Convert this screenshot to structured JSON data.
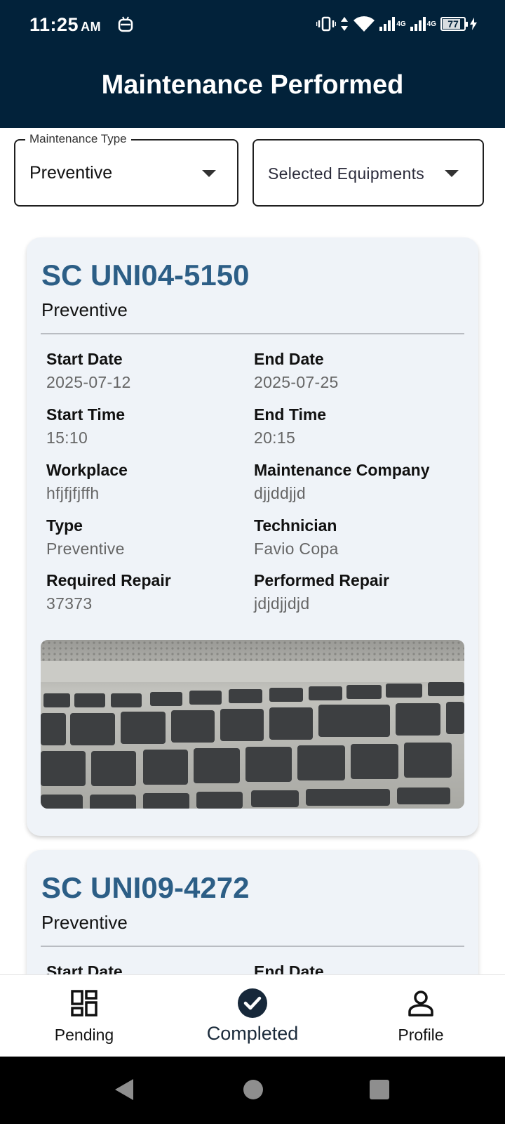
{
  "status_bar": {
    "time": "11:25",
    "ampm": "AM",
    "network_1": "4G",
    "network_2": "4G",
    "battery": "77"
  },
  "app_bar": {
    "title": "Maintenance Performed"
  },
  "filters": {
    "maintenance_type": {
      "label": "Maintenance Type",
      "value": "Preventive"
    },
    "equipments": {
      "value": "Selected Equipments"
    }
  },
  "records": [
    {
      "title": "SC UNI04-5150",
      "subtitle": "Preventive",
      "fields": {
        "start_date": {
          "label": "Start Date",
          "value": "2025-07-12"
        },
        "end_date": {
          "label": "End Date",
          "value": "2025-07-25"
        },
        "start_time": {
          "label": "Start Time",
          "value": "15:10"
        },
        "end_time": {
          "label": "End Time",
          "value": "20:15"
        },
        "workplace": {
          "label": "Workplace",
          "value": "hfjfjfjffh"
        },
        "maintenance_company": {
          "label": "Maintenance Company",
          "value": "djjddjjd"
        },
        "type": {
          "label": "Type",
          "value": "Preventive"
        },
        "technician": {
          "label": "Technician",
          "value": "Favio Copa"
        },
        "required_repair": {
          "label": "Required Repair",
          "value": "37373"
        },
        "performed_repair": {
          "label": "Performed Repair",
          "value": "jdjdjjdjd"
        }
      },
      "photo": "keyboard-photo"
    },
    {
      "title": "SC UNI09-4272",
      "subtitle": "Preventive",
      "fields": {
        "start_date": {
          "label": "Start Date"
        },
        "end_date": {
          "label": "End Date"
        }
      }
    }
  ],
  "bottom_nav": {
    "pending": {
      "label": "Pending",
      "icon": "dashboard-icon"
    },
    "completed": {
      "label": "Completed",
      "icon": "check-circle-icon"
    },
    "profile": {
      "label": "Profile",
      "icon": "person-icon"
    }
  },
  "colors": {
    "header_bg": "#02223a",
    "title_blue": "#2c5e86",
    "card_bg": "#eff3f8"
  }
}
